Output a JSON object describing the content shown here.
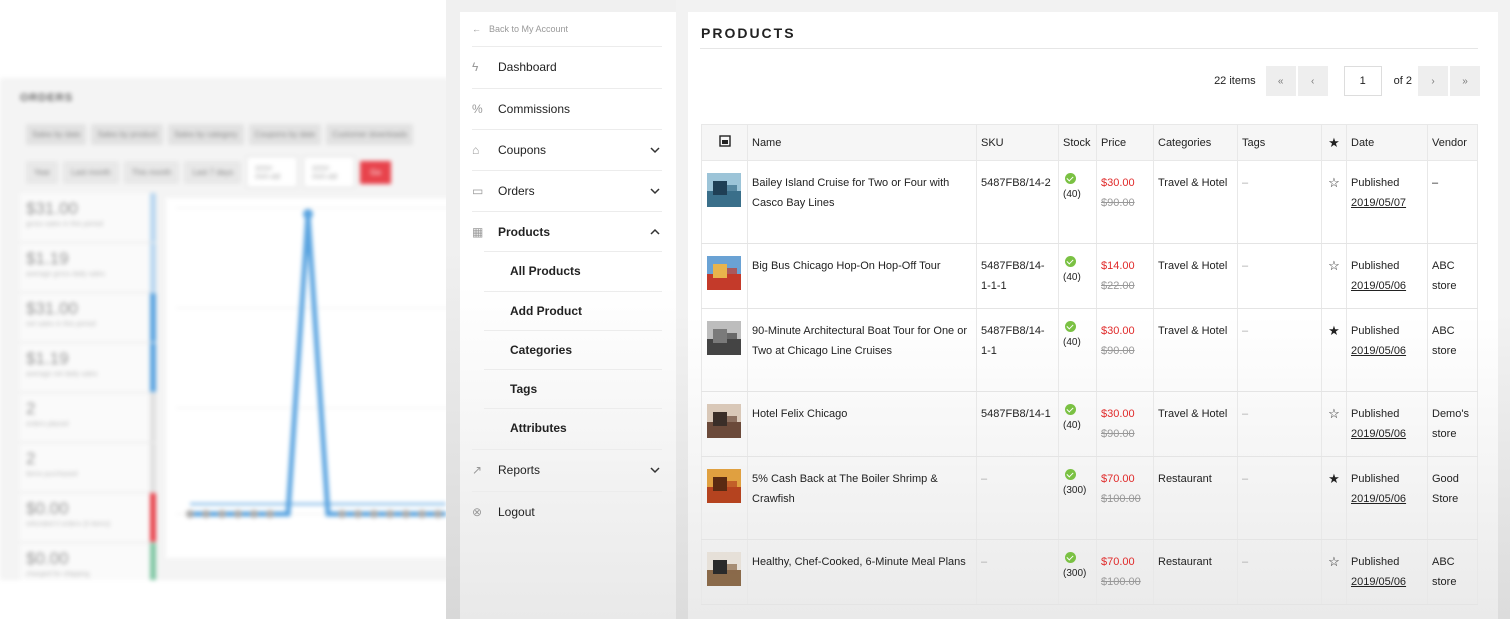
{
  "background_panel": {
    "title": "ORDERS",
    "tabs": [
      "Sales by date",
      "Sales by product",
      "Sales by category",
      "Coupons by date",
      "Customer downloads"
    ],
    "ranges": [
      "Year",
      "Last month",
      "This month",
      "Last 7 days"
    ],
    "date_placeholder": "yyyy-mm-dd",
    "go_label": "Go",
    "stats": [
      {
        "value": "$31.00",
        "label": "gross sales in this period",
        "color": "#b9d7f0"
      },
      {
        "value": "$1.19",
        "label": "average gross daily sales",
        "color": "#b9d7f0"
      },
      {
        "value": "$31.00",
        "label": "net sales in this period",
        "color": "#5aa4e0"
      },
      {
        "value": "$1.19",
        "label": "average net daily sales",
        "color": "#5aa4e0"
      },
      {
        "value": "2",
        "label": "orders placed",
        "color": "#e0e0e0"
      },
      {
        "value": "2",
        "label": "items purchased",
        "color": "#e0e0e0"
      },
      {
        "value": "$0.00",
        "label": "refunded 0 orders (0 items)",
        "color": "#e8434c"
      },
      {
        "value": "$0.00",
        "label": "charged for shipping",
        "color": "#7fc7a4"
      }
    ]
  },
  "sidebar": {
    "back_label": "Back to My Account",
    "items": [
      {
        "label": "Dashboard",
        "icon": "bolt-icon",
        "glyph": "ϟ",
        "expandable": false
      },
      {
        "label": "Commissions",
        "icon": "percent-icon",
        "glyph": "%",
        "expandable": false
      },
      {
        "label": "Coupons",
        "icon": "tag-icon",
        "glyph": "⌂",
        "expandable": true,
        "expanded": false
      },
      {
        "label": "Orders",
        "icon": "cart-icon",
        "glyph": "▭",
        "expandable": true,
        "expanded": false
      },
      {
        "label": "Products",
        "icon": "boxes-icon",
        "glyph": "▦",
        "expandable": true,
        "expanded": true
      },
      {
        "label": "Reports",
        "icon": "chart-icon",
        "glyph": "↗",
        "expandable": true,
        "expanded": false
      },
      {
        "label": "Logout",
        "icon": "logout-icon",
        "glyph": "⊗",
        "expandable": false
      }
    ],
    "product_subitems": [
      "All Products",
      "Add Product",
      "Categories",
      "Tags",
      "Attributes"
    ]
  },
  "main": {
    "title": "PRODUCTS",
    "pagination": {
      "items_count": "22 items",
      "first": "«",
      "prev": "‹",
      "current_page": "1",
      "of_label": "of 2",
      "next": "›",
      "last": "»"
    },
    "columns": [
      "Name",
      "SKU",
      "Stock",
      "Price",
      "Categories",
      "Tags",
      "Date",
      "Vendor"
    ],
    "rows": [
      {
        "name": "Bailey Island Cruise for Two or Four with Casco Bay Lines",
        "sku": "5487FB8/14-2",
        "stock": "(40)",
        "sale": "$30.00",
        "regular": "$90.00",
        "category": "Travel & Hotel",
        "tags": "–",
        "featured": false,
        "status": "Published",
        "date": "2019/05/07",
        "vendor": "–",
        "thumb_colors": [
          "#3a6f8a",
          "#9cc4d8",
          "#1f3f55"
        ]
      },
      {
        "name": "Big Bus Chicago Hop-On Hop-Off Tour",
        "sku": "5487FB8/14-1-1-1",
        "stock": "(40)",
        "sale": "$14.00",
        "regular": "$22.00",
        "category": "Travel & Hotel",
        "tags": "–",
        "featured": false,
        "status": "Published",
        "date": "2019/05/06",
        "vendor": "ABC store",
        "thumb_colors": [
          "#c43a2a",
          "#6aa2d4",
          "#e9b44c"
        ]
      },
      {
        "name": "90-Minute Architectural Boat Tour for One or Two at Chicago Line Cruises",
        "sku": "5487FB8/14-1-1",
        "stock": "(40)",
        "sale": "$30.00",
        "regular": "$90.00",
        "category": "Travel & Hotel",
        "tags": "–",
        "featured": true,
        "status": "Published",
        "date": "2019/05/06",
        "vendor": "ABC store",
        "thumb_colors": [
          "#444444",
          "#bdbdbd",
          "#7a7a7a"
        ]
      },
      {
        "name": "Hotel Felix Chicago",
        "sku": "5487FB8/14-1",
        "stock": "(40)",
        "sale": "$30.00",
        "regular": "$90.00",
        "category": "Travel & Hotel",
        "tags": "–",
        "featured": false,
        "status": "Published",
        "date": "2019/05/06",
        "vendor": "Demo's store",
        "thumb_colors": [
          "#6b4a3a",
          "#d9c8b8",
          "#3a2e28"
        ]
      },
      {
        "name": "5% Cash Back at The Boiler Shrimp & Crawfish",
        "sku": "–",
        "stock": "(300)",
        "sale": "$70.00",
        "regular": "$100.00",
        "category": "Restaurant",
        "tags": "–",
        "featured": true,
        "status": "Published",
        "date": "2019/05/06",
        "vendor": "Good Store",
        "thumb_colors": [
          "#b5431f",
          "#e0a040",
          "#5a2a12"
        ]
      },
      {
        "name": "Healthy, Chef-Cooked, 6-Minute Meal Plans",
        "sku": "–",
        "stock": "(300)",
        "sale": "$70.00",
        "regular": "$100.00",
        "category": "Restaurant",
        "tags": "–",
        "featured": false,
        "status": "Published",
        "date": "2019/05/06",
        "vendor": "ABC store",
        "thumb_colors": [
          "#8a6a4a",
          "#e6e0d8",
          "#2a2a2a"
        ]
      }
    ]
  },
  "colors": {
    "accent_red": "#e02a2a",
    "stock_green": "#7ac143",
    "muted": "#999999"
  }
}
